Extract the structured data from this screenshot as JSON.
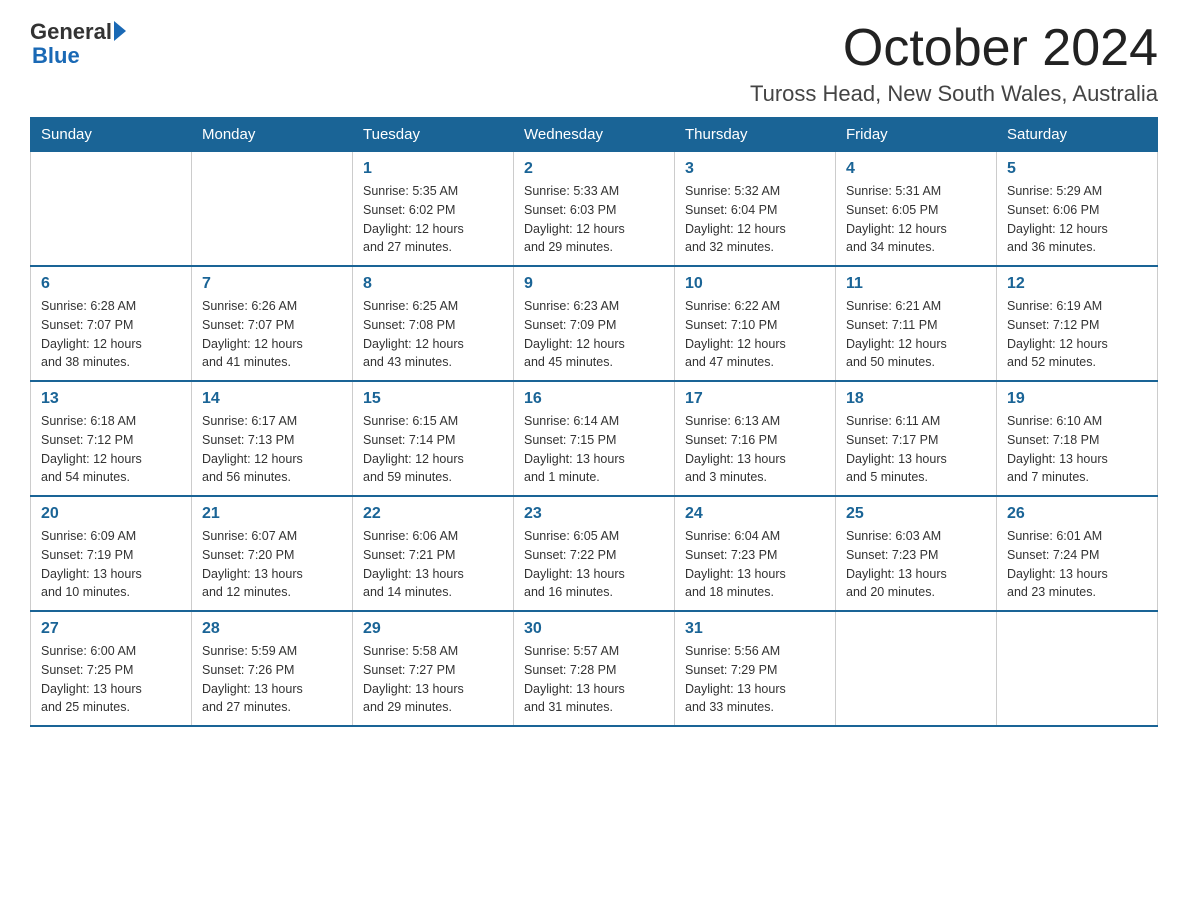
{
  "header": {
    "logo": {
      "general": "General",
      "blue": "Blue"
    },
    "title": "October 2024",
    "location": "Tuross Head, New South Wales, Australia"
  },
  "days_of_week": [
    "Sunday",
    "Monday",
    "Tuesday",
    "Wednesday",
    "Thursday",
    "Friday",
    "Saturday"
  ],
  "weeks": [
    [
      {
        "day": "",
        "info": ""
      },
      {
        "day": "",
        "info": ""
      },
      {
        "day": "1",
        "info": "Sunrise: 5:35 AM\nSunset: 6:02 PM\nDaylight: 12 hours\nand 27 minutes."
      },
      {
        "day": "2",
        "info": "Sunrise: 5:33 AM\nSunset: 6:03 PM\nDaylight: 12 hours\nand 29 minutes."
      },
      {
        "day": "3",
        "info": "Sunrise: 5:32 AM\nSunset: 6:04 PM\nDaylight: 12 hours\nand 32 minutes."
      },
      {
        "day": "4",
        "info": "Sunrise: 5:31 AM\nSunset: 6:05 PM\nDaylight: 12 hours\nand 34 minutes."
      },
      {
        "day": "5",
        "info": "Sunrise: 5:29 AM\nSunset: 6:06 PM\nDaylight: 12 hours\nand 36 minutes."
      }
    ],
    [
      {
        "day": "6",
        "info": "Sunrise: 6:28 AM\nSunset: 7:07 PM\nDaylight: 12 hours\nand 38 minutes."
      },
      {
        "day": "7",
        "info": "Sunrise: 6:26 AM\nSunset: 7:07 PM\nDaylight: 12 hours\nand 41 minutes."
      },
      {
        "day": "8",
        "info": "Sunrise: 6:25 AM\nSunset: 7:08 PM\nDaylight: 12 hours\nand 43 minutes."
      },
      {
        "day": "9",
        "info": "Sunrise: 6:23 AM\nSunset: 7:09 PM\nDaylight: 12 hours\nand 45 minutes."
      },
      {
        "day": "10",
        "info": "Sunrise: 6:22 AM\nSunset: 7:10 PM\nDaylight: 12 hours\nand 47 minutes."
      },
      {
        "day": "11",
        "info": "Sunrise: 6:21 AM\nSunset: 7:11 PM\nDaylight: 12 hours\nand 50 minutes."
      },
      {
        "day": "12",
        "info": "Sunrise: 6:19 AM\nSunset: 7:12 PM\nDaylight: 12 hours\nand 52 minutes."
      }
    ],
    [
      {
        "day": "13",
        "info": "Sunrise: 6:18 AM\nSunset: 7:12 PM\nDaylight: 12 hours\nand 54 minutes."
      },
      {
        "day": "14",
        "info": "Sunrise: 6:17 AM\nSunset: 7:13 PM\nDaylight: 12 hours\nand 56 minutes."
      },
      {
        "day": "15",
        "info": "Sunrise: 6:15 AM\nSunset: 7:14 PM\nDaylight: 12 hours\nand 59 minutes."
      },
      {
        "day": "16",
        "info": "Sunrise: 6:14 AM\nSunset: 7:15 PM\nDaylight: 13 hours\nand 1 minute."
      },
      {
        "day": "17",
        "info": "Sunrise: 6:13 AM\nSunset: 7:16 PM\nDaylight: 13 hours\nand 3 minutes."
      },
      {
        "day": "18",
        "info": "Sunrise: 6:11 AM\nSunset: 7:17 PM\nDaylight: 13 hours\nand 5 minutes."
      },
      {
        "day": "19",
        "info": "Sunrise: 6:10 AM\nSunset: 7:18 PM\nDaylight: 13 hours\nand 7 minutes."
      }
    ],
    [
      {
        "day": "20",
        "info": "Sunrise: 6:09 AM\nSunset: 7:19 PM\nDaylight: 13 hours\nand 10 minutes."
      },
      {
        "day": "21",
        "info": "Sunrise: 6:07 AM\nSunset: 7:20 PM\nDaylight: 13 hours\nand 12 minutes."
      },
      {
        "day": "22",
        "info": "Sunrise: 6:06 AM\nSunset: 7:21 PM\nDaylight: 13 hours\nand 14 minutes."
      },
      {
        "day": "23",
        "info": "Sunrise: 6:05 AM\nSunset: 7:22 PM\nDaylight: 13 hours\nand 16 minutes."
      },
      {
        "day": "24",
        "info": "Sunrise: 6:04 AM\nSunset: 7:23 PM\nDaylight: 13 hours\nand 18 minutes."
      },
      {
        "day": "25",
        "info": "Sunrise: 6:03 AM\nSunset: 7:23 PM\nDaylight: 13 hours\nand 20 minutes."
      },
      {
        "day": "26",
        "info": "Sunrise: 6:01 AM\nSunset: 7:24 PM\nDaylight: 13 hours\nand 23 minutes."
      }
    ],
    [
      {
        "day": "27",
        "info": "Sunrise: 6:00 AM\nSunset: 7:25 PM\nDaylight: 13 hours\nand 25 minutes."
      },
      {
        "day": "28",
        "info": "Sunrise: 5:59 AM\nSunset: 7:26 PM\nDaylight: 13 hours\nand 27 minutes."
      },
      {
        "day": "29",
        "info": "Sunrise: 5:58 AM\nSunset: 7:27 PM\nDaylight: 13 hours\nand 29 minutes."
      },
      {
        "day": "30",
        "info": "Sunrise: 5:57 AM\nSunset: 7:28 PM\nDaylight: 13 hours\nand 31 minutes."
      },
      {
        "day": "31",
        "info": "Sunrise: 5:56 AM\nSunset: 7:29 PM\nDaylight: 13 hours\nand 33 minutes."
      },
      {
        "day": "",
        "info": ""
      },
      {
        "day": "",
        "info": ""
      }
    ]
  ]
}
